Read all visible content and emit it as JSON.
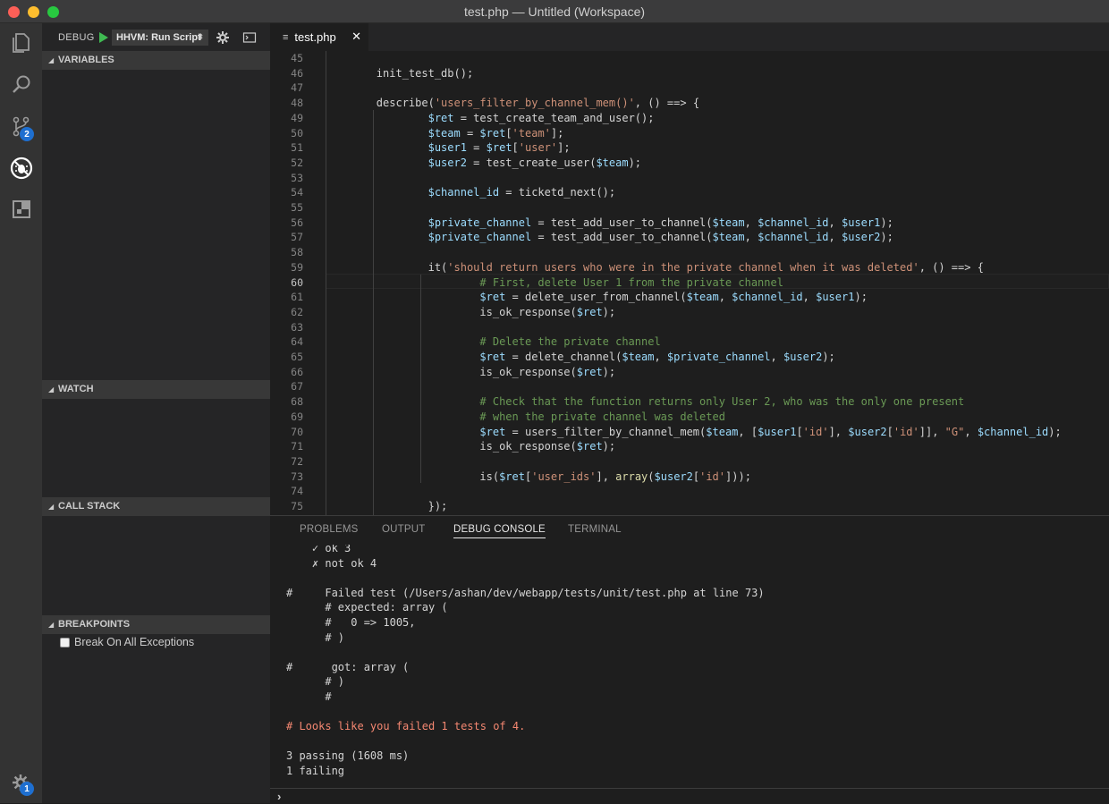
{
  "window": {
    "title": "test.php — Untitled (Workspace)"
  },
  "activity_bar": {
    "items": [
      {
        "name": "explorer-icon"
      },
      {
        "name": "search-icon"
      },
      {
        "name": "source-control-icon",
        "badge": "2"
      },
      {
        "name": "debug-icon"
      },
      {
        "name": "extensions-icon"
      }
    ],
    "settings_badge": "1"
  },
  "debug_toolbar": {
    "label": "DEBUG",
    "configuration": "HHVM: Run Script"
  },
  "sidebar": {
    "sections": {
      "variables": "VARIABLES",
      "watch": "WATCH",
      "call_stack": "CALL STACK",
      "breakpoints": "BREAKPOINTS"
    },
    "breakpoint_items": [
      {
        "label": "Break On All Exceptions",
        "checked": false
      }
    ]
  },
  "editor": {
    "tab": {
      "label": "test.php"
    },
    "current_line": "60",
    "lines": [
      {
        "n": "45",
        "code": ""
      },
      {
        "n": "46",
        "code": "        init_test_db();"
      },
      {
        "n": "47",
        "code": ""
      },
      {
        "n": "48",
        "code": "        describe('users_filter_by_channel_mem()', () ==> {"
      },
      {
        "n": "49",
        "code": "                $ret = test_create_team_and_user();"
      },
      {
        "n": "50",
        "code": "                $team = $ret['team'];"
      },
      {
        "n": "51",
        "code": "                $user1 = $ret['user'];"
      },
      {
        "n": "52",
        "code": "                $user2 = test_create_user($team);"
      },
      {
        "n": "53",
        "code": ""
      },
      {
        "n": "54",
        "code": "                $channel_id = ticketd_next();"
      },
      {
        "n": "55",
        "code": ""
      },
      {
        "n": "56",
        "code": "                $private_channel = test_add_user_to_channel($team, $channel_id, $user1);"
      },
      {
        "n": "57",
        "code": "                $private_channel = test_add_user_to_channel($team, $channel_id, $user2);"
      },
      {
        "n": "58",
        "code": ""
      },
      {
        "n": "59",
        "code": "                it('should return users who were in the private channel when it was deleted', () ==> {"
      },
      {
        "n": "60",
        "code": "                        # First, delete User 1 from the private channel"
      },
      {
        "n": "61",
        "code": "                        $ret = delete_user_from_channel($team, $channel_id, $user1);"
      },
      {
        "n": "62",
        "code": "                        is_ok_response($ret);"
      },
      {
        "n": "63",
        "code": ""
      },
      {
        "n": "64",
        "code": "                        # Delete the private channel"
      },
      {
        "n": "65",
        "code": "                        $ret = delete_channel($team, $private_channel, $user2);"
      },
      {
        "n": "66",
        "code": "                        is_ok_response($ret);"
      },
      {
        "n": "67",
        "code": ""
      },
      {
        "n": "68",
        "code": "                        # Check that the function returns only User 2, who was the only one present"
      },
      {
        "n": "69",
        "code": "                        # when the private channel was deleted"
      },
      {
        "n": "70",
        "code": "                        $ret = users_filter_by_channel_mem($team, [$user1['id'], $user2['id']], \"G\", $channel_id);"
      },
      {
        "n": "71",
        "code": "                        is_ok_response($ret);"
      },
      {
        "n": "72",
        "code": ""
      },
      {
        "n": "73",
        "code": "                        is($ret['user_ids'], array($user2['id']));"
      },
      {
        "n": "74",
        "code": ""
      },
      {
        "n": "75",
        "code": "                });"
      }
    ]
  },
  "panel": {
    "tabs": [
      "PROBLEMS",
      "OUTPUT",
      "DEBUG CONSOLE",
      "TERMINAL"
    ],
    "active_tab": "DEBUG CONSOLE",
    "console_lines": [
      {
        "text": "    ✓ ok 3",
        "type": "normal"
      },
      {
        "text": "    ✗ not ok 4",
        "type": "normal"
      },
      {
        "text": "",
        "type": "normal"
      },
      {
        "text": "#     Failed test (/Users/ashan/dev/webapp/tests/unit/test.php at line 73)",
        "type": "normal"
      },
      {
        "text": "      # expected: array (",
        "type": "normal"
      },
      {
        "text": "      #   0 => 1005,",
        "type": "normal"
      },
      {
        "text": "      # )",
        "type": "normal"
      },
      {
        "text": "",
        "type": "normal"
      },
      {
        "text": "#      got: array (",
        "type": "normal"
      },
      {
        "text": "      # )",
        "type": "normal"
      },
      {
        "text": "      #",
        "type": "normal"
      },
      {
        "text": "",
        "type": "normal"
      },
      {
        "text": "# Looks like you failed 1 tests of 4.",
        "type": "error"
      },
      {
        "text": "",
        "type": "normal"
      },
      {
        "text": "3 passing (1608 ms)",
        "type": "normal"
      },
      {
        "text": "1 failing",
        "type": "normal"
      }
    ],
    "prompt": "›"
  }
}
